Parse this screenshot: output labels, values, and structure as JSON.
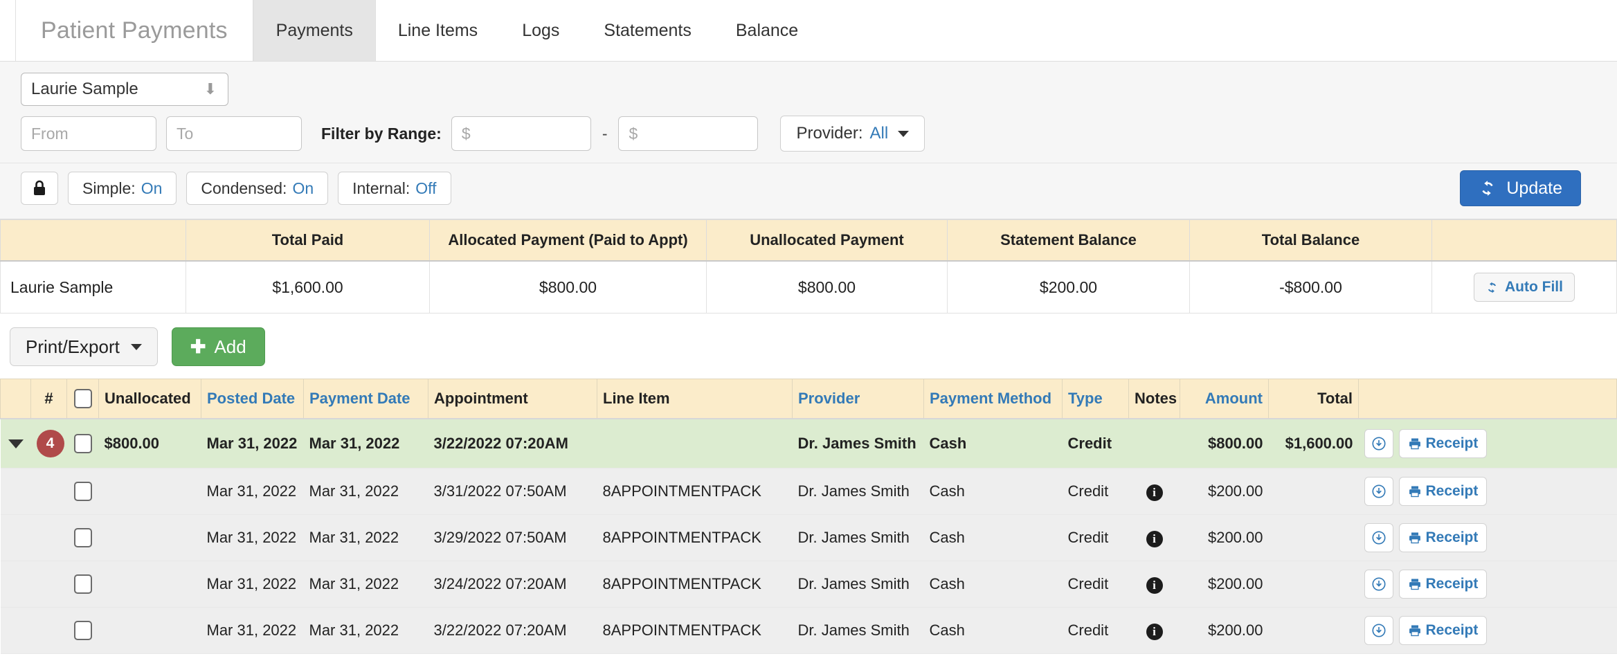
{
  "tabs": {
    "brand": "Patient Payments",
    "items": [
      {
        "label": "Payments",
        "active": true
      },
      {
        "label": "Line Items",
        "active": false
      },
      {
        "label": "Logs",
        "active": false
      },
      {
        "label": "Statements",
        "active": false
      },
      {
        "label": "Balance",
        "active": false
      }
    ]
  },
  "filters": {
    "patient_selected": "Laurie Sample",
    "from_placeholder": "From",
    "from_value": "",
    "to_placeholder": "To",
    "to_value": "",
    "range_label": "Filter by Range:",
    "range_min_placeholder": "$",
    "range_min_value": "",
    "range_dash": "-",
    "range_max_placeholder": "$",
    "range_max_value": "",
    "provider_label": "Provider:",
    "provider_value": "All"
  },
  "toggles": {
    "lock_icon": "lock-icon",
    "simple_label": "Simple:",
    "simple_value": "On",
    "condensed_label": "Condensed:",
    "condensed_value": "On",
    "internal_label": "Internal:",
    "internal_value": "Off",
    "update_label": "Update"
  },
  "summary": {
    "headers": [
      "",
      "Total Paid",
      "Allocated Payment (Paid to Appt)",
      "Unallocated Payment",
      "Statement Balance",
      "Total Balance",
      ""
    ],
    "row": {
      "name": "Laurie Sample",
      "total_paid": "$1,600.00",
      "allocated_payment": "$800.00",
      "unallocated_payment": "$800.00",
      "statement_balance": "$200.00",
      "total_balance": "-$800.00",
      "autofill_label": "Auto Fill"
    }
  },
  "actions": {
    "print_export_label": "Print/Export",
    "add_label": "Add"
  },
  "grid": {
    "headers": [
      {
        "label": "",
        "link": false
      },
      {
        "label": "#",
        "link": false
      },
      {
        "label": "",
        "link": false
      },
      {
        "label": "Unallocated",
        "link": false
      },
      {
        "label": "Posted Date",
        "link": true
      },
      {
        "label": "Payment Date",
        "link": true
      },
      {
        "label": "Appointment",
        "link": false
      },
      {
        "label": "Line Item",
        "link": false
      },
      {
        "label": "Provider",
        "link": true
      },
      {
        "label": "Payment Method",
        "link": true
      },
      {
        "label": "Type",
        "link": true
      },
      {
        "label": "Notes",
        "link": false
      },
      {
        "label": "Amount",
        "link": true
      },
      {
        "label": "Total",
        "link": false
      },
      {
        "label": "",
        "link": false
      }
    ],
    "receipt_label": "Receipt",
    "parent_row": {
      "count_badge": "4",
      "unallocated": "$800.00",
      "posted_date": "Mar 31, 2022",
      "payment_date": "Mar 31, 2022",
      "appointment": "3/22/2022 07:20AM",
      "line_item": "",
      "provider": "Dr. James Smith",
      "payment_method": "Cash",
      "type": "Credit",
      "notes": "",
      "amount": "$800.00",
      "total": "$1,600.00"
    },
    "child_rows": [
      {
        "unallocated": "",
        "posted_date": "Mar 31, 2022",
        "payment_date": "Mar 31, 2022",
        "appointment": "3/31/2022 07:50AM",
        "line_item": "8APPOINTMENTPACK",
        "provider": "Dr. James Smith",
        "payment_method": "Cash",
        "type": "Credit",
        "notes": "info",
        "amount": "$200.00",
        "total": ""
      },
      {
        "unallocated": "",
        "posted_date": "Mar 31, 2022",
        "payment_date": "Mar 31, 2022",
        "appointment": "3/29/2022 07:50AM",
        "line_item": "8APPOINTMENTPACK",
        "provider": "Dr. James Smith",
        "payment_method": "Cash",
        "type": "Credit",
        "notes": "info",
        "amount": "$200.00",
        "total": ""
      },
      {
        "unallocated": "",
        "posted_date": "Mar 31, 2022",
        "payment_date": "Mar 31, 2022",
        "appointment": "3/24/2022 07:20AM",
        "line_item": "8APPOINTMENTPACK",
        "provider": "Dr. James Smith",
        "payment_method": "Cash",
        "type": "Credit",
        "notes": "info",
        "amount": "$200.00",
        "total": ""
      },
      {
        "unallocated": "",
        "posted_date": "Mar 31, 2022",
        "payment_date": "Mar 31, 2022",
        "appointment": "3/22/2022 07:20AM",
        "line_item": "8APPOINTMENTPACK",
        "provider": "Dr. James Smith",
        "payment_method": "Cash",
        "type": "Credit",
        "notes": "info",
        "amount": "$200.00",
        "total": ""
      }
    ]
  },
  "colors": {
    "header_tan": "#fbecca",
    "parent_row_green": "#dcecd0",
    "link_blue": "#337ab7",
    "primary_blue": "#2f6fbf",
    "add_green": "#5cab5c",
    "badge_red": "#b04a4a"
  }
}
